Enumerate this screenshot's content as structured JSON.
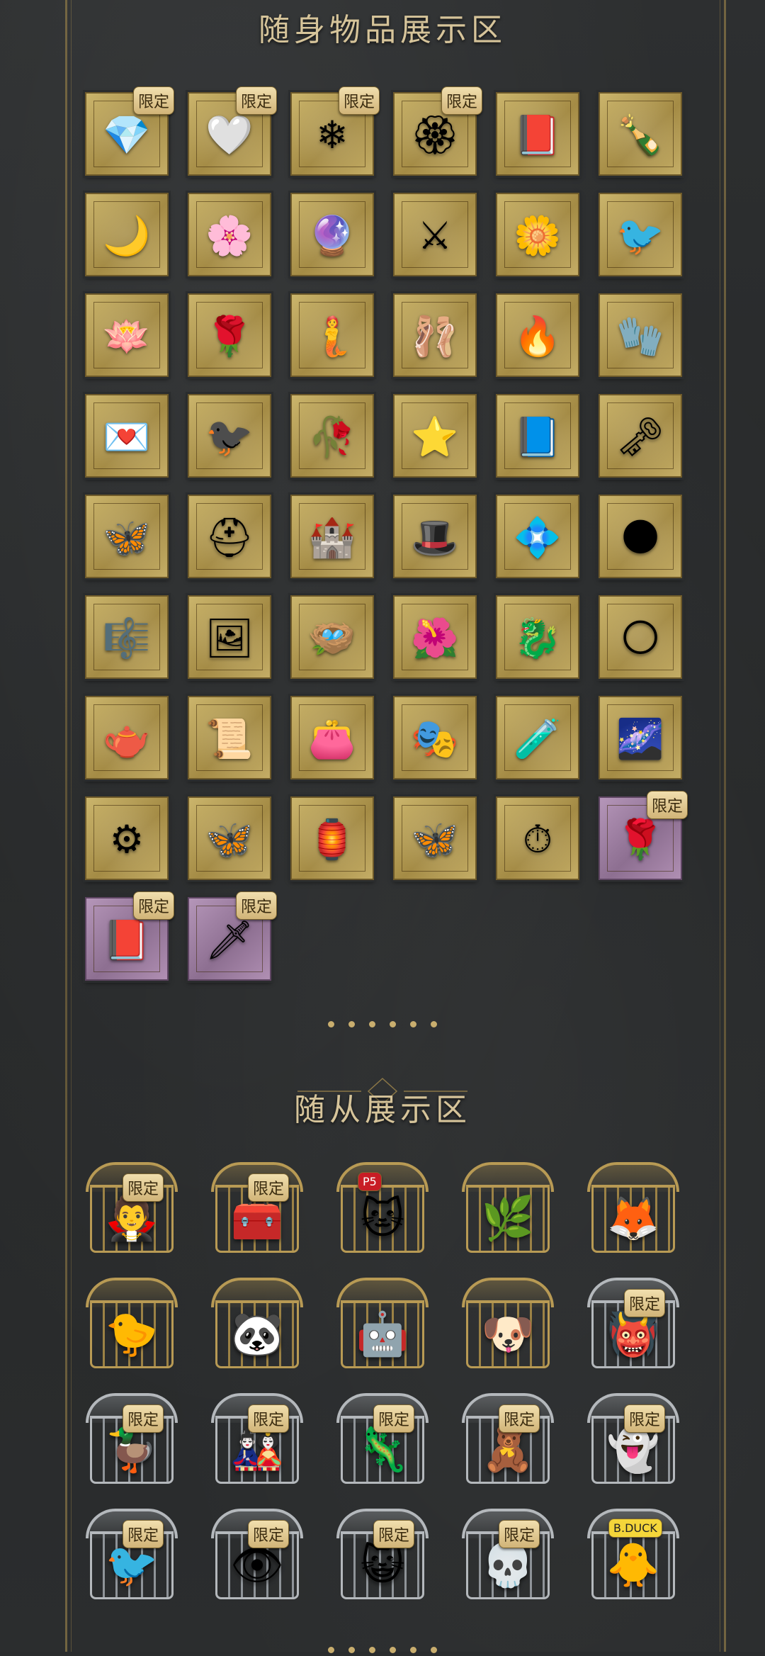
{
  "accessory_section": {
    "title": "随身物品展示区",
    "items": [
      {
        "icon": "heart-crystal-icon",
        "glyph": "💎",
        "limited": true,
        "style": "gold"
      },
      {
        "icon": "silver-heart-icon",
        "glyph": "🤍",
        "limited": true,
        "style": "gold"
      },
      {
        "icon": "ice-crystal-icon",
        "glyph": "❄",
        "limited": true,
        "style": "gold"
      },
      {
        "icon": "jade-ornament-icon",
        "glyph": "🏵",
        "limited": true,
        "style": "gold"
      },
      {
        "icon": "red-book-icon",
        "glyph": "📕",
        "limited": false,
        "style": "gold"
      },
      {
        "icon": "champagne-bottle-icon",
        "glyph": "🍾",
        "limited": false,
        "style": "gold"
      },
      {
        "icon": "crescent-cat-icon",
        "glyph": "🌙",
        "limited": false,
        "style": "gold"
      },
      {
        "icon": "flower-branch-icon",
        "glyph": "🌸",
        "limited": false,
        "style": "gold"
      },
      {
        "icon": "magic-orb-icon",
        "glyph": "🔮",
        "limited": false,
        "style": "gold"
      },
      {
        "icon": "scythe-icon",
        "glyph": "⚔",
        "limited": false,
        "style": "gold"
      },
      {
        "icon": "yellow-rose-icon",
        "glyph": "🌼",
        "limited": false,
        "style": "gold"
      },
      {
        "icon": "phoenix-bird-icon",
        "glyph": "🐦",
        "limited": false,
        "style": "gold"
      },
      {
        "icon": "blue-lotus-icon",
        "glyph": "🪷",
        "limited": false,
        "style": "gold"
      },
      {
        "icon": "white-rose-icon",
        "glyph": "🌹",
        "limited": false,
        "style": "gold"
      },
      {
        "icon": "mermaid-tail-icon",
        "glyph": "🧜",
        "limited": false,
        "style": "gold"
      },
      {
        "icon": "ballerina-icon",
        "glyph": "🩰",
        "limited": false,
        "style": "gold"
      },
      {
        "icon": "torch-crystal-icon",
        "glyph": "🔥",
        "limited": false,
        "style": "gold"
      },
      {
        "icon": "claw-glove-icon",
        "glyph": "🧤",
        "limited": false,
        "style": "gold"
      },
      {
        "icon": "winged-letter-icon",
        "glyph": "💌",
        "limited": false,
        "style": "gold"
      },
      {
        "icon": "raven-glove-icon",
        "glyph": "🐦‍⬛",
        "limited": false,
        "style": "gold"
      },
      {
        "icon": "rose-brooch-icon",
        "glyph": "🥀",
        "limited": false,
        "style": "gold"
      },
      {
        "icon": "star-lantern-icon",
        "glyph": "⭐",
        "limited": false,
        "style": "gold"
      },
      {
        "icon": "blue-book-icon",
        "glyph": "📘",
        "limited": false,
        "style": "gold"
      },
      {
        "icon": "gold-key-icon",
        "glyph": "🗝",
        "limited": false,
        "style": "gold"
      },
      {
        "icon": "blue-butterfly-icon",
        "glyph": "🦋",
        "limited": false,
        "style": "gold"
      },
      {
        "icon": "knight-helmet-icon",
        "glyph": "⛑",
        "limited": false,
        "style": "gold"
      },
      {
        "icon": "ice-castle-icon",
        "glyph": "🏰",
        "limited": false,
        "style": "gold"
      },
      {
        "icon": "witch-hat-icon",
        "glyph": "🎩",
        "limited": false,
        "style": "gold"
      },
      {
        "icon": "crystal-heart-icon",
        "glyph": "💠",
        "limited": false,
        "style": "gold"
      },
      {
        "icon": "dark-flame-icon",
        "glyph": "🌑",
        "limited": false,
        "style": "gold"
      },
      {
        "icon": "harmonica-icon",
        "glyph": "🎼",
        "limited": false,
        "style": "gold"
      },
      {
        "icon": "silver-frame-icon",
        "glyph": "🖼",
        "limited": false,
        "style": "gold"
      },
      {
        "icon": "blue-nest-icon",
        "glyph": "🪺",
        "limited": false,
        "style": "gold"
      },
      {
        "icon": "blossom-mask-icon",
        "glyph": "🌺",
        "limited": false,
        "style": "gold"
      },
      {
        "icon": "ice-dragon-icon",
        "glyph": "🐉",
        "limited": false,
        "style": "gold"
      },
      {
        "icon": "moon-staff-icon",
        "glyph": "🌕",
        "limited": false,
        "style": "gold"
      },
      {
        "icon": "pink-teacup-icon",
        "glyph": "🫖",
        "limited": false,
        "style": "gold"
      },
      {
        "icon": "scroll-icon",
        "glyph": "📜",
        "limited": false,
        "style": "gold"
      },
      {
        "icon": "purple-pouch-icon",
        "glyph": "👛",
        "limited": false,
        "style": "gold"
      },
      {
        "icon": "ghost-mask-icon",
        "glyph": "🎭",
        "limited": false,
        "style": "gold"
      },
      {
        "icon": "potion-bottle-icon",
        "glyph": "🧪",
        "limited": false,
        "style": "gold"
      },
      {
        "icon": "galaxy-pot-icon",
        "glyph": "🌌",
        "limited": false,
        "style": "gold"
      },
      {
        "icon": "mech-claw-icon",
        "glyph": "⚙",
        "limited": false,
        "style": "gold"
      },
      {
        "icon": "butterfly-staff-icon",
        "glyph": "🦋",
        "limited": false,
        "style": "gold"
      },
      {
        "icon": "silver-lantern-icon",
        "glyph": "🏮",
        "limited": false,
        "style": "gold"
      },
      {
        "icon": "teal-butterfly-icon",
        "glyph": "🦋",
        "limited": false,
        "style": "gold"
      },
      {
        "icon": "pocket-watch-icon",
        "glyph": "⏱",
        "limited": false,
        "style": "gold"
      },
      {
        "icon": "rose-bouquet-icon",
        "glyph": "🌹",
        "limited": true,
        "style": "purple"
      },
      {
        "icon": "red-book-frame-icon",
        "glyph": "📕",
        "limited": true,
        "style": "purple"
      },
      {
        "icon": "golden-dagger-icon",
        "glyph": "🗡",
        "limited": true,
        "style": "purple"
      }
    ]
  },
  "companion_section": {
    "title": "随从展示区",
    "items": [
      {
        "icon": "gothic-doll-icon",
        "glyph": "🧛",
        "limited": true,
        "cage": "gold"
      },
      {
        "icon": "red-chest-icon",
        "glyph": "🧰",
        "limited": true,
        "cage": "gold"
      },
      {
        "icon": "masked-cat-icon",
        "glyph": "🐱",
        "limited": false,
        "cage": "gold",
        "tag": "P5"
      },
      {
        "icon": "plant-spirit-icon",
        "glyph": "🌿",
        "limited": false,
        "cage": "gold"
      },
      {
        "icon": "white-fox-icon",
        "glyph": "🦊",
        "limited": false,
        "cage": "gold"
      },
      {
        "icon": "fire-chicks-icon",
        "glyph": "🐤",
        "limited": false,
        "cage": "gold"
      },
      {
        "icon": "panda-gentleman-icon",
        "glyph": "🐼",
        "limited": false,
        "cage": "gold"
      },
      {
        "icon": "robot-machine-icon",
        "glyph": "🤖",
        "limited": false,
        "cage": "gold"
      },
      {
        "icon": "white-dog-icon",
        "glyph": "🐶",
        "limited": false,
        "cage": "gold"
      },
      {
        "icon": "flower-monster-icon",
        "glyph": "👹",
        "limited": true,
        "cage": "silver"
      },
      {
        "icon": "duck-doll-icon",
        "glyph": "🦆",
        "limited": true,
        "cage": "silver"
      },
      {
        "icon": "puppet-doll-icon",
        "glyph": "🎎",
        "limited": true,
        "cage": "silver"
      },
      {
        "icon": "chameleon-icon",
        "glyph": "🦎",
        "limited": true,
        "cage": "silver"
      },
      {
        "icon": "teddy-bear-icon",
        "glyph": "🧸",
        "limited": true,
        "cage": "silver"
      },
      {
        "icon": "dark-phantom-icon",
        "glyph": "👻",
        "limited": true,
        "cage": "silver"
      },
      {
        "icon": "robot-bird-icon",
        "glyph": "🐦",
        "limited": true,
        "cage": "silver"
      },
      {
        "icon": "red-eye-icon",
        "glyph": "👁",
        "limited": true,
        "cage": "silver"
      },
      {
        "icon": "monocle-cat-icon",
        "glyph": "😺",
        "limited": true,
        "cage": "silver"
      },
      {
        "icon": "skeleton-imp-icon",
        "glyph": "💀",
        "limited": true,
        "cage": "silver"
      },
      {
        "icon": "yellow-duck-icon",
        "glyph": "🐥",
        "limited": false,
        "cage": "silver",
        "tag": "B.DUCK"
      }
    ]
  },
  "limited_label": "限定"
}
